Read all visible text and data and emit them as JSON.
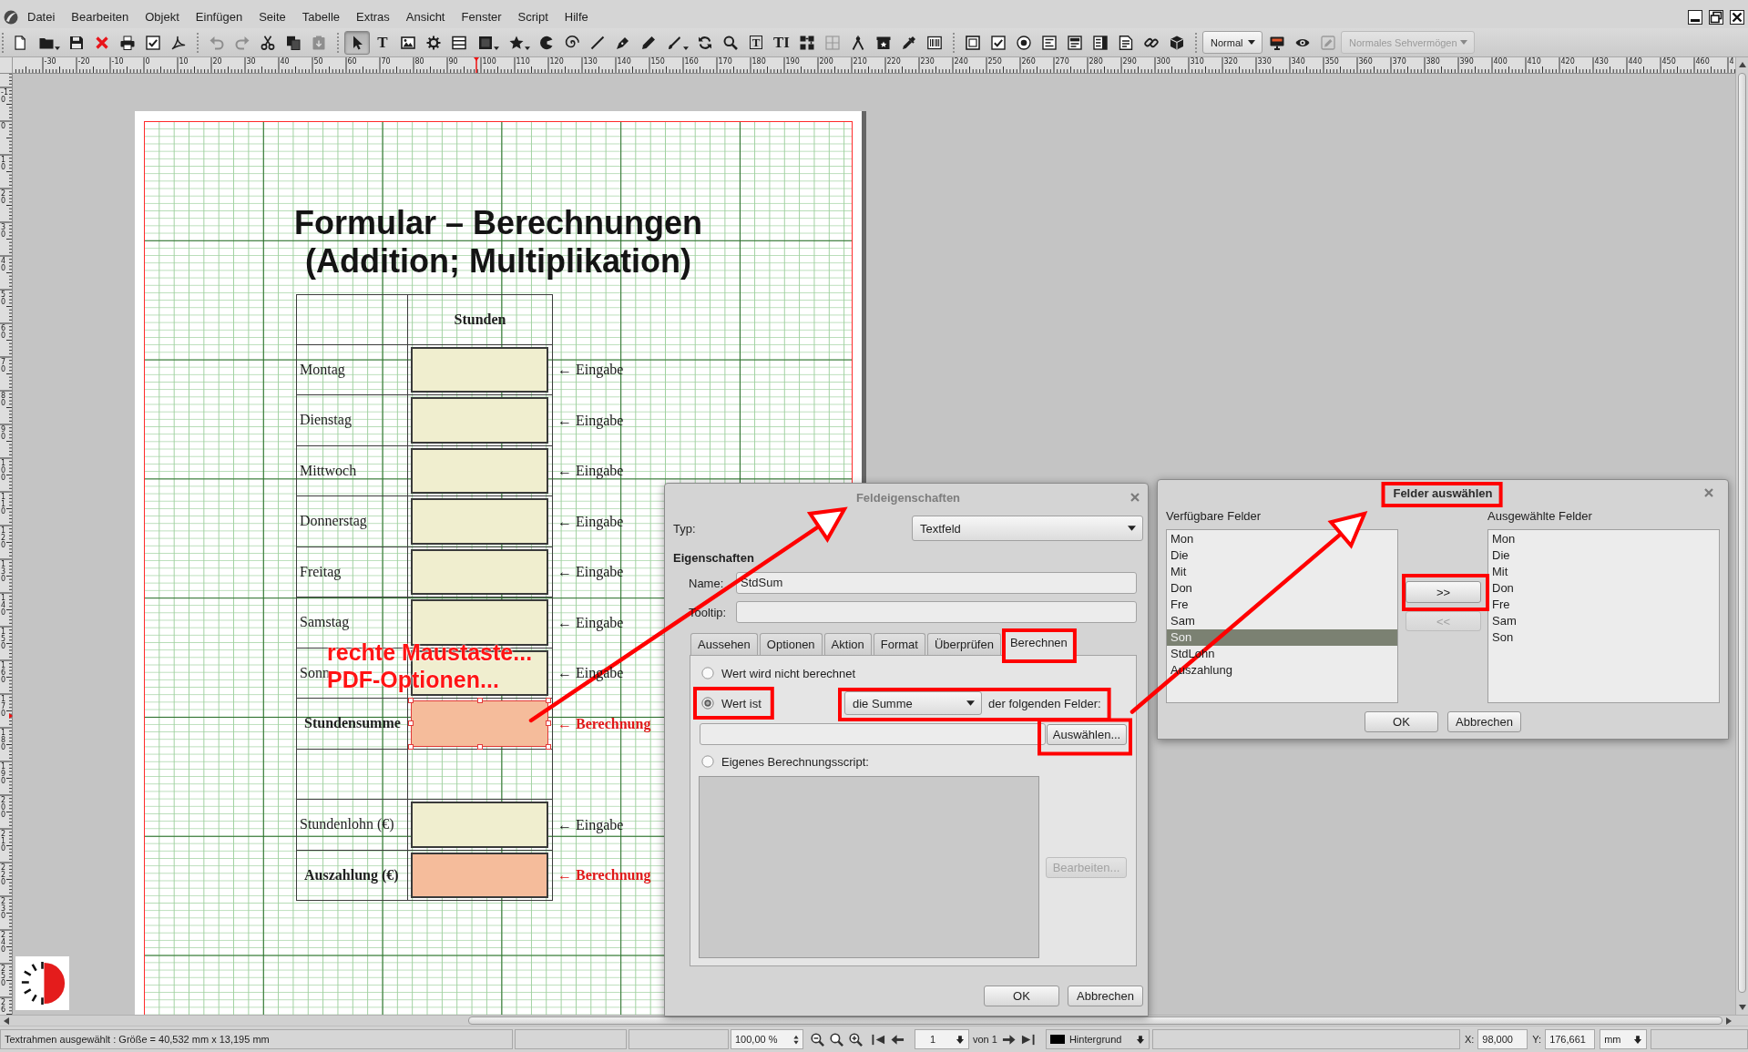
{
  "menubar": {
    "items": [
      "Datei",
      "Bearbeiten",
      "Objekt",
      "Einfügen",
      "Seite",
      "Tabelle",
      "Extras",
      "Ansicht",
      "Fenster",
      "Script",
      "Hilfe"
    ]
  },
  "toolbar": {
    "actions": [
      {
        "disabled": false
      },
      {
        "disabled": false
      },
      {
        "disabled": false
      },
      {
        "disabled": false
      },
      {
        "disabled": false
      },
      {
        "disabled": false
      },
      {
        "disabled": false
      },
      {
        "disabled": true
      },
      {
        "disabled": true
      },
      {
        "disabled": false
      },
      {
        "disabled": false
      },
      {
        "disabled": true
      },
      {
        "disabled": false
      },
      {
        "disabled": false
      },
      {
        "disabled": true
      }
    ],
    "tools": [
      {
        "selected": true,
        "disabled": false
      },
      {
        "glyph": "T",
        "selected": false,
        "disabled": false
      },
      {
        "selected": false,
        "disabled": false
      },
      {
        "selected": false,
        "disabled": false
      },
      {
        "selected": false,
        "disabled": false
      },
      {
        "selected": false,
        "disabled": false
      },
      {
        "selected": false,
        "disabled": false
      },
      {
        "selected": false,
        "disabled": false
      },
      {
        "selected": false,
        "disabled": false
      },
      {
        "selected": false,
        "disabled": false
      },
      {
        "selected": false,
        "disabled": false
      },
      {
        "selected": false,
        "disabled": false
      },
      {
        "selected": false,
        "disabled": false
      },
      {
        "selected": false,
        "disabled": false
      },
      {
        "selected": false,
        "disabled": false
      },
      {
        "glyph": "T",
        "selected": false,
        "disabled": false
      },
      {
        "glyph": "TI",
        "selected": false,
        "disabled": false
      },
      {
        "selected": false,
        "disabled": false
      },
      {
        "selected": false,
        "disabled": true
      },
      {
        "selected": false,
        "disabled": false
      },
      {
        "selected": false,
        "disabled": false
      },
      {
        "selected": false,
        "disabled": false
      },
      {
        "selected": false,
        "disabled": false
      },
      {
        "selected": false,
        "disabled": false
      },
      {
        "selected": false,
        "disabled": false
      },
      {
        "selected": false,
        "disabled": false
      },
      {
        "selected": false,
        "disabled": false
      },
      {
        "selected": false,
        "disabled": false
      },
      {
        "selected": false,
        "disabled": false
      },
      {
        "selected": false,
        "disabled": false
      },
      {
        "selected": false,
        "disabled": false
      },
      {
        "selected": false,
        "disabled": false
      }
    ],
    "preview_mode": "Normal",
    "vision_mode": {
      "value": "Normales Sehvermögen",
      "disabled": true
    }
  },
  "ruler": {
    "horizontal_labels": [
      "-30",
      "-20",
      "-10",
      "0",
      "10",
      "20",
      "30",
      "40",
      "50",
      "60",
      "70",
      "80",
      "90",
      "100",
      "110",
      "120",
      "130",
      "140",
      "150",
      "160",
      "170",
      "180",
      "190",
      "200",
      "210",
      "220",
      "230",
      "240",
      "250",
      "260",
      "270",
      "280",
      "290",
      "300",
      "310",
      "320",
      "330",
      "340",
      "350",
      "360",
      "370",
      "380",
      "390",
      "400",
      "410",
      "420",
      "430",
      "440",
      "450",
      "460",
      "4"
    ],
    "vertical_labels": [
      "-10",
      "0",
      "10",
      "20",
      "30",
      "40",
      "50",
      "60",
      "70",
      "80",
      "90",
      "100",
      "110",
      "120",
      "130",
      "140",
      "150",
      "160",
      "170",
      "180",
      "190",
      "200",
      "210",
      "220",
      "230",
      "240",
      "250",
      "26"
    ]
  },
  "document": {
    "title": "Formular – Berechnungen\n(Addition; Multiplikation)",
    "table": {
      "header": "Stunden",
      "rows": [
        {
          "kind": "input",
          "label": "Montag",
          "note": "← Eingabe",
          "selected": false
        },
        {
          "kind": "input",
          "label": "Dienstag",
          "note": "← Eingabe",
          "selected": false
        },
        {
          "kind": "input",
          "label": "Mittwoch",
          "note": "← Eingabe",
          "selected": false
        },
        {
          "kind": "input",
          "label": "Donnerstag",
          "note": "← Eingabe",
          "selected": false
        },
        {
          "kind": "input",
          "label": "Freitag",
          "note": "← Eingabe",
          "selected": false
        },
        {
          "kind": "input",
          "label": "Samstag",
          "note": "← Eingabe",
          "selected": false
        },
        {
          "kind": "input",
          "label": "Sonn",
          "note": "← Eingabe",
          "selected": false
        },
        {
          "kind": "calc",
          "label": "Stundensumme",
          "note": "← Berechnung",
          "selected": true
        },
        {
          "kind": "blank"
        },
        {
          "kind": "input",
          "label": "Stundenlohn (€)",
          "note": "← Eingabe",
          "selected": false
        },
        {
          "kind": "calc",
          "label": "Auszahlung (€)",
          "note": "← Berechnung",
          "selected": false
        }
      ]
    }
  },
  "annotation": {
    "lines": [
      "rechte Maustaste...",
      "PDF-Optionen..."
    ]
  },
  "field_properties_dialog": {
    "title": "Feldeigenschaften",
    "active": false,
    "type_label": "Typ:",
    "type_value": "Textfeld",
    "section_label": "Eigenschaften",
    "name_label": "Name:",
    "name_value": "StdSum",
    "tooltip_label": "Tooltip:",
    "tabs": [
      {
        "label": "Aussehen",
        "selected": false
      },
      {
        "label": "Optionen",
        "selected": false
      },
      {
        "label": "Aktion",
        "selected": false
      },
      {
        "label": "Format",
        "selected": false
      },
      {
        "label": "Überprüfen",
        "selected": false
      },
      {
        "label": "Berechnen",
        "selected": true
      }
    ],
    "options": [
      {
        "label": "Wert wird nicht berechnet",
        "selected": false
      },
      {
        "label": "Wert ist",
        "selected": true
      },
      {
        "label": "Eigenes Berechnungsscript:",
        "selected": false
      }
    ],
    "function_value": "die Summe",
    "fields_label": "der folgenden Felder:",
    "select_button": "Auswählen...",
    "edit_button": {
      "label": "Bearbeiten...",
      "disabled": true
    },
    "buttons": [
      "OK",
      "Abbrechen"
    ]
  },
  "select_fields_dialog": {
    "title": "Felder auswählen",
    "active": true,
    "available_label": "Verfügbare Felder",
    "chosen_label": "Ausgewählte Felder",
    "available": [
      {
        "label": "Mon",
        "selected": false
      },
      {
        "label": "Die",
        "selected": false
      },
      {
        "label": "Mit",
        "selected": false
      },
      {
        "label": "Don",
        "selected": false
      },
      {
        "label": "Fre",
        "selected": false
      },
      {
        "label": "Sam",
        "selected": false
      },
      {
        "label": "Son",
        "selected": true
      },
      {
        "label": "StdLohn",
        "selected": false
      },
      {
        "label": "Auszahlung",
        "selected": false
      }
    ],
    "chosen": [
      {
        "label": "Mon",
        "selected": false
      },
      {
        "label": "Die",
        "selected": false
      },
      {
        "label": "Mit",
        "selected": false
      },
      {
        "label": "Don",
        "selected": false
      },
      {
        "label": "Fre",
        "selected": false
      },
      {
        "label": "Sam",
        "selected": false
      },
      {
        "label": "Son",
        "selected": false
      }
    ],
    "add_button": {
      "label": ">>",
      "disabled": false
    },
    "remove_button": {
      "label": "<<",
      "disabled": true
    },
    "buttons": [
      "OK",
      "Abbrechen"
    ]
  },
  "status_bar": {
    "message": "Textrahmen ausgewählt : Größe = 40,532 mm x 13,195 mm",
    "zoom": "100,00 %",
    "page": "1",
    "page_count": "von 1",
    "layer": "Hintergrund",
    "x_label": "X:",
    "x_value": "98,000",
    "y_label": "Y:",
    "y_value": "176,661",
    "unit": "mm"
  }
}
